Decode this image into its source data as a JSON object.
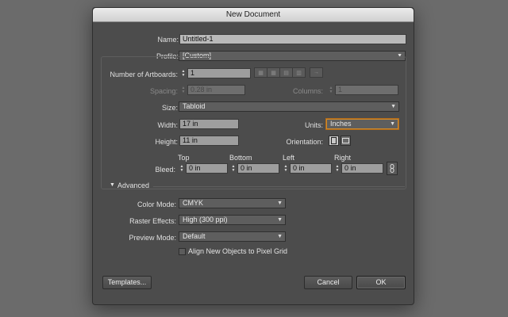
{
  "dialog": {
    "title": "New Document"
  },
  "name": {
    "label": "Name:",
    "value": "Untitled-1"
  },
  "profile": {
    "label": "Profile:",
    "value": "[Custom]"
  },
  "artboards": {
    "label": "Number of Artboards:",
    "value": "1",
    "arrow_glyph": "→"
  },
  "spacing": {
    "label": "Spacing:",
    "value": "0.28 in"
  },
  "columns": {
    "label": "Columns:",
    "value": "1"
  },
  "size": {
    "label": "Size:",
    "value": "Tabloid"
  },
  "width": {
    "label": "Width:",
    "value": "17 in"
  },
  "units": {
    "label": "Units:",
    "value": "Inches"
  },
  "height": {
    "label": "Height:",
    "value": "11 in"
  },
  "orientation": {
    "label": "Orientation:",
    "selected": "portrait"
  },
  "bleed": {
    "label": "Bleed:",
    "top": {
      "label": "Top",
      "value": "0 in"
    },
    "bottom": {
      "label": "Bottom",
      "value": "0 in"
    },
    "left": {
      "label": "Left",
      "value": "0 in"
    },
    "right": {
      "label": "Right",
      "value": "0 in"
    },
    "link_icon": "chain-link-icon"
  },
  "advanced": {
    "label": "Advanced",
    "expanded": true,
    "color_mode": {
      "label": "Color Mode:",
      "value": "CMYK"
    },
    "raster_effects": {
      "label": "Raster Effects:",
      "value": "High (300 ppi)"
    },
    "preview_mode": {
      "label": "Preview Mode:",
      "value": "Default"
    },
    "pixel_grid": {
      "label": "Align New Objects to Pixel Grid",
      "checked": false
    }
  },
  "buttons": {
    "templates": "Templates...",
    "cancel": "Cancel",
    "ok": "OK"
  },
  "glyphs": {
    "dropdown": "▼",
    "spin_up": "▲",
    "spin_down": "▼",
    "disclosure": "▼"
  },
  "colors": {
    "dialog_bg": "#4c4c4c",
    "focus_ring": "#d08a2a",
    "page_bg": "#6b6b6b"
  }
}
